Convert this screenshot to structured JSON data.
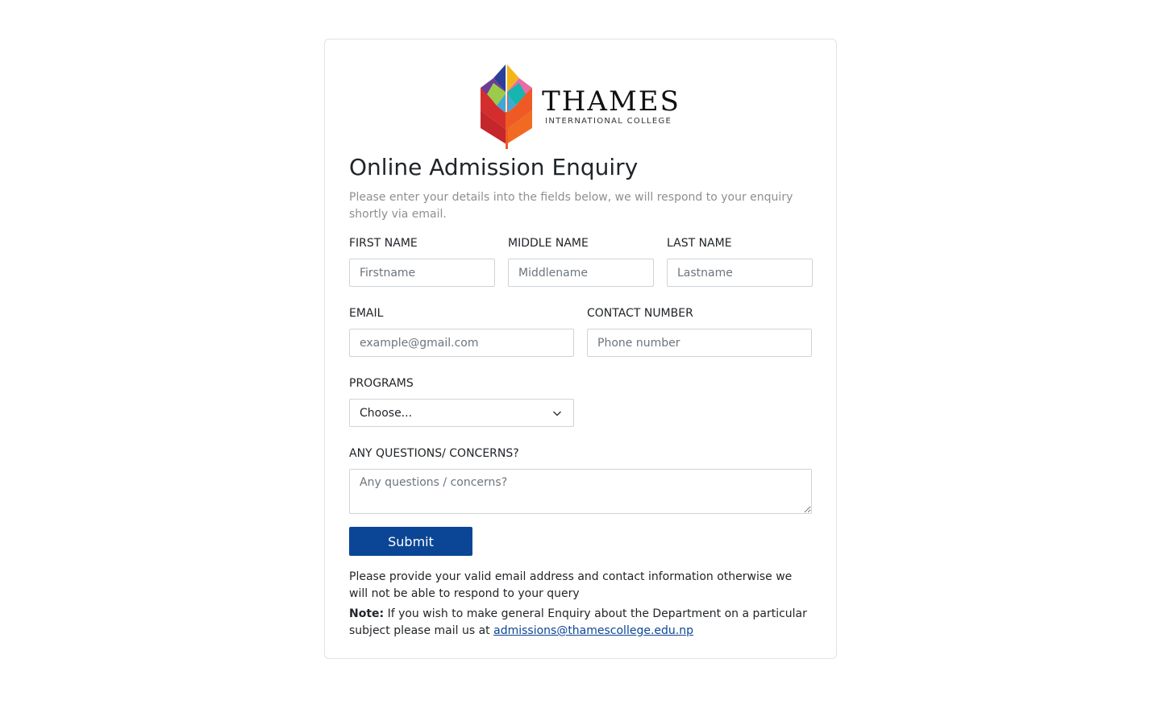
{
  "logo": {
    "name": "THAMES",
    "subtitle": "INTERNATIONAL COLLEGE"
  },
  "form": {
    "title": "Online Admission Enquiry",
    "subtitle": "Please enter your details into the fields below, we will respond to your enquiry shortly via email.",
    "first_name": {
      "label": "FIRST NAME",
      "placeholder": "Firstname"
    },
    "middle_name": {
      "label": "MIDDLE NAME",
      "placeholder": "Middlename"
    },
    "last_name": {
      "label": "LAST NAME",
      "placeholder": "Lastname"
    },
    "email": {
      "label": "EMAIL",
      "placeholder": "example@gmail.com"
    },
    "contact": {
      "label": "CONTACT NUMBER",
      "placeholder": "Phone number"
    },
    "programs": {
      "label": "PROGRAMS",
      "selected": "Choose..."
    },
    "questions": {
      "label": "ANY QUESTIONS/ CONCERNS?",
      "placeholder": "Any questions / concerns?"
    },
    "submit_label": "Submit"
  },
  "footer": {
    "info": "Please provide your valid email address and contact information otherwise we will not be able to respond to your query",
    "note_label": "Note:",
    "note_text": " If you wish to make general Enquiry about the Department on a particular subject please mail us at ",
    "email_link": "admissions@thamescollege.edu.np"
  },
  "colors": {
    "primary": "#0b4696",
    "border": "#ced4da",
    "muted": "#8f8f8f"
  }
}
